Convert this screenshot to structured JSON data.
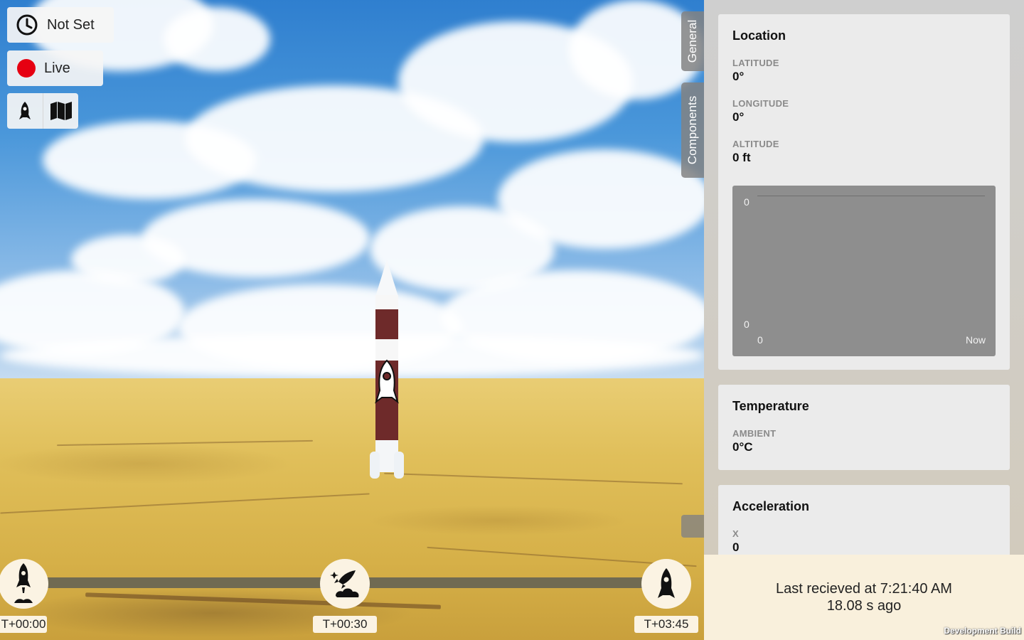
{
  "toolbar": {
    "time_label": "Not Set",
    "time_icon": "clock-icon",
    "live_label": "Live",
    "live_color": "#e60012",
    "view_modes": [
      "rocket-view-icon",
      "map-view-icon"
    ]
  },
  "side_tabs": [
    "General",
    "Components"
  ],
  "timeline": {
    "events": [
      {
        "label": "T+00:00",
        "icon": "rocket-launch-icon"
      },
      {
        "label": "T+00:30",
        "icon": "rocket-apogee-icon"
      },
      {
        "label": "T+03:45",
        "icon": "rocket-landing-icon"
      }
    ]
  },
  "panel": {
    "location": {
      "title": "Location",
      "latitude_label": "LATITUDE",
      "latitude_value": "0°",
      "longitude_label": "LONGITUDE",
      "longitude_value": "0°",
      "altitude_label": "ALTITUDE",
      "altitude_value": "0 ft",
      "chart": {
        "y_max": "0",
        "y_min": "0",
        "x_start": "0",
        "x_end": "Now"
      }
    },
    "temperature": {
      "title": "Temperature",
      "ambient_label": "AMBIENT",
      "ambient_value": "0°C"
    },
    "acceleration": {
      "title": "Acceleration",
      "x_label": "X",
      "x_value": "0"
    }
  },
  "footer": {
    "last_received": "Last recieved at 7:21:40 AM",
    "ago": "18.08 s ago",
    "build": "Development Build"
  }
}
